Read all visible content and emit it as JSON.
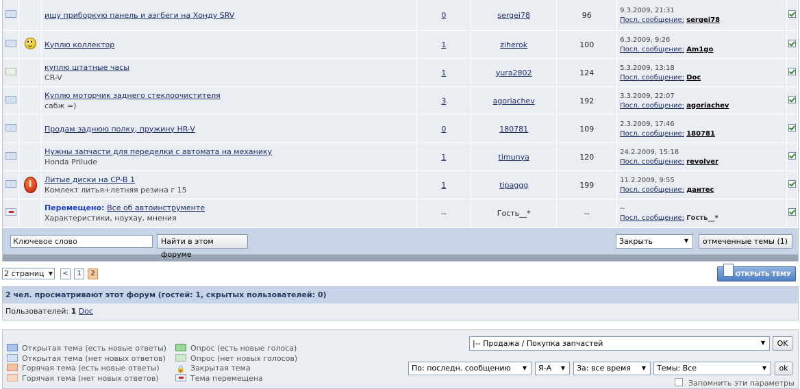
{
  "topics": [
    {
      "icon": "envelope-icon",
      "icon2": "",
      "title": "ищу приборкую панель и аэгбеги на Хонду SRV",
      "desc": "",
      "prefix": "",
      "replies": "0",
      "author": "sergei78",
      "views": "96",
      "last_date": "9.3.2009, 21:31",
      "last_label": "Посл. сообщение:",
      "last_user": "sergei78"
    },
    {
      "icon": "envelope-icon",
      "icon2": "smiley-icon",
      "title": "Куплю коллектор",
      "desc": "",
      "prefix": "",
      "replies": "1",
      "author": "ziherok",
      "views": "100",
      "last_date": "6.3.2009, 9:26",
      "last_label": "Посл. сообщение:",
      "last_user": "Am1go"
    },
    {
      "icon": "poll-icon",
      "icon2": "",
      "title": "куплю штатные часы",
      "desc": "CR-V",
      "prefix": "",
      "replies": "1",
      "author": "yura2802",
      "views": "124",
      "last_date": "5.3.2009, 13:18",
      "last_label": "Посл. сообщение:",
      "last_user": "Doc"
    },
    {
      "icon": "envelope-icon",
      "icon2": "",
      "title": "Куплю моторчик заднего стеклоочистителя",
      "desc": "сабж =)",
      "prefix": "",
      "replies": "3",
      "author": "agoriachev",
      "views": "192",
      "last_date": "3.3.2009, 22:07",
      "last_label": "Посл. сообщение:",
      "last_user": "agoriachev"
    },
    {
      "icon": "envelope-icon",
      "icon2": "",
      "title": "Продам заднюю полку, пружину HR-V",
      "desc": "",
      "prefix": "",
      "replies": "0",
      "author": "180781",
      "views": "109",
      "last_date": "2.3.2009, 17:46",
      "last_label": "Посл. сообщение:",
      "last_user": "180781"
    },
    {
      "icon": "envelope-icon",
      "icon2": "",
      "title": "Нужны запчасти для переделки с автомата на механику",
      "desc": "Honda Prilude",
      "prefix": "",
      "replies": "1",
      "author": "timunya",
      "views": "120",
      "last_date": "24.2.2009, 15:18",
      "last_label": "Посл. сообщение:",
      "last_user": "revolver"
    },
    {
      "icon": "envelope-icon",
      "icon2": "info-icon",
      "title": "Литые диски на CP-B 1",
      "desc": "Комлект литья+летняя резина г 15",
      "prefix": "",
      "replies": "1",
      "author": "tipaggg",
      "views": "199",
      "last_date": "11.2.2009, 9:55",
      "last_label": "Посл. сообщение:",
      "last_user": "дантес"
    },
    {
      "icon": "moved-icon",
      "icon2": "",
      "title": "Все об автоинструменте",
      "desc": "Характеристики, ноухау, мнения",
      "prefix": "Перемещено:",
      "replies": "--",
      "author": "Гость__*",
      "views": "--",
      "last_date": "--",
      "last_label": "Посл. сообщение:",
      "last_user": "Гость__*"
    }
  ],
  "search": {
    "keyword_value": "Ключевое слово",
    "find_label": "Найти в этом форуме",
    "action_value": "Закрыть",
    "marked_label": "отмеченные темы (1)"
  },
  "pager": {
    "pages_label": "2 страниц",
    "prev": "<",
    "page1": "1",
    "page2": "2"
  },
  "open_topic_label": "ОТКРЫТЬ ТЕМУ",
  "viewers": {
    "header": "2 чел. просматривают этот форум (гостей: 1, скрытых пользователей: 0)",
    "users_label": "Пользователей:",
    "users_count": "1",
    "user": "Doc"
  },
  "legend": {
    "col1": [
      "Открытая тема (есть новые ответы)",
      "Открытая тема (нет новых ответов)",
      "Горячая тема (есть новые ответы)",
      "Горячая тема (нет новых ответов)"
    ],
    "col2": [
      "Опрос (есть новые голоса)",
      "Опрос (нет новых голосов)",
      "Закрытая тема",
      "Тема перемещена"
    ]
  },
  "controls": {
    "forum_select": "|-- Продажа / Покупка запчастей",
    "ok": "OK",
    "sort_by": "По: последн. сообщению",
    "sort_order": "Я-А",
    "period": "За: все время",
    "topics": "Темы: Все",
    "ok2": "ok",
    "remember": "Запомнить эти параметры"
  },
  "colors": {
    "header_bar": "#c7d3e6",
    "row_bg": "#eaedf1",
    "link": "#1c2e73",
    "moved": "#1a3fd6",
    "current_page": "#f6c79a"
  }
}
